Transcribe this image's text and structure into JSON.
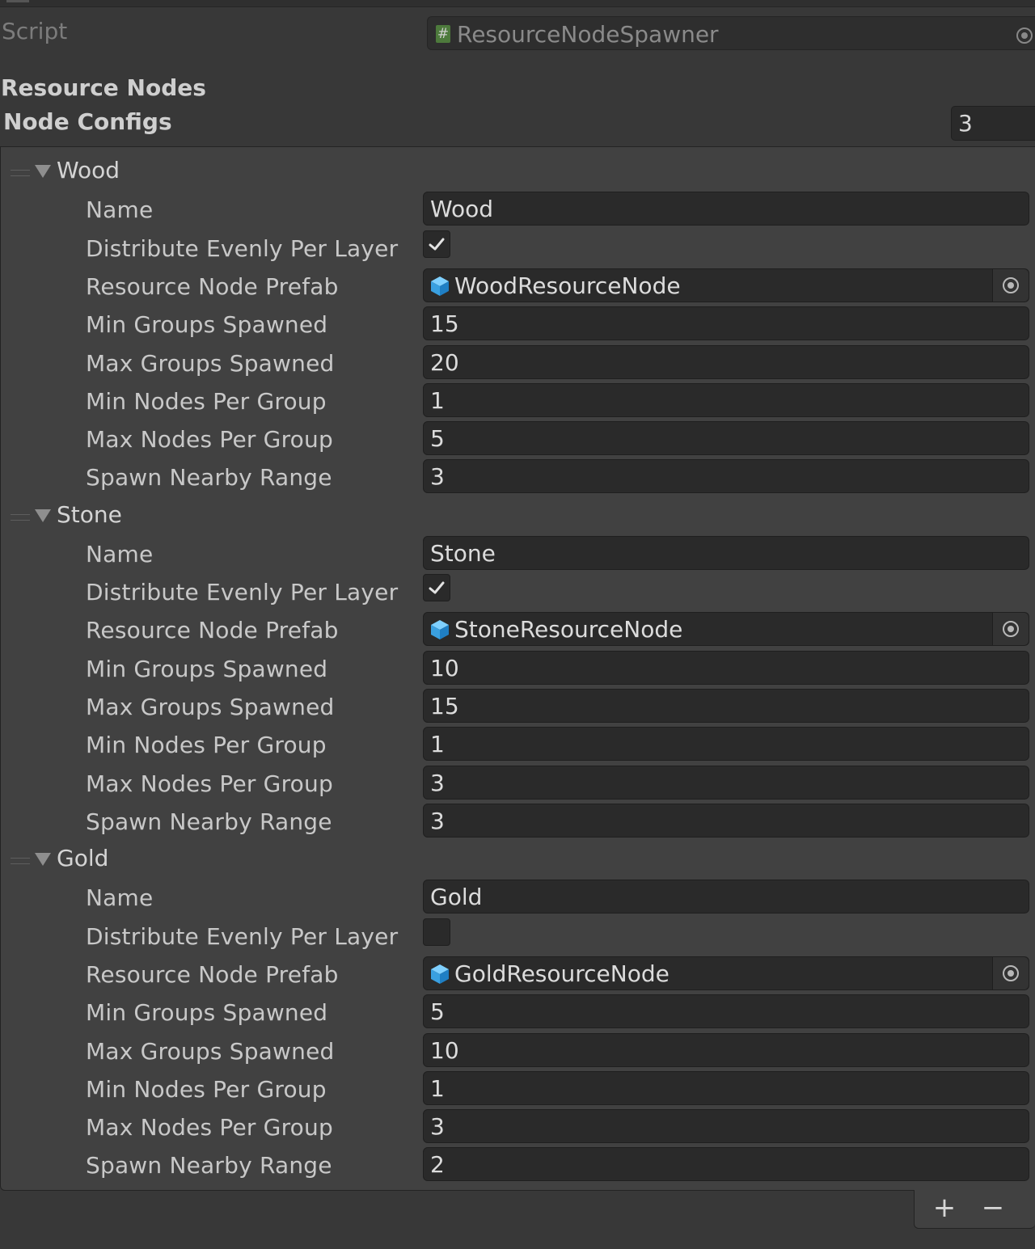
{
  "script": {
    "label": "Script",
    "value": "ResourceNodeSpawner"
  },
  "section_header": "Resource Nodes",
  "list": {
    "label": "Node Configs",
    "size": "3",
    "fields": {
      "name": "Name",
      "distribute": "Distribute Evenly Per Layer",
      "prefab": "Resource Node Prefab",
      "min_groups": "Min Groups Spawned",
      "max_groups": "Max Groups Spawned",
      "min_nodes": "Min Nodes Per Group",
      "max_nodes": "Max Nodes Per Group",
      "range": "Spawn Nearby Range"
    },
    "elements": [
      {
        "title": "Wood",
        "name": "Wood",
        "distribute": true,
        "prefab": "WoodResourceNode",
        "min_groups": "15",
        "max_groups": "20",
        "min_nodes": "1",
        "max_nodes": "5",
        "range": "3"
      },
      {
        "title": "Stone",
        "name": "Stone",
        "distribute": true,
        "prefab": "StoneResourceNode",
        "min_groups": "10",
        "max_groups": "15",
        "min_nodes": "1",
        "max_nodes": "3",
        "range": "3"
      },
      {
        "title": "Gold",
        "name": "Gold",
        "distribute": false,
        "prefab": "GoldResourceNode",
        "min_groups": "5",
        "max_groups": "10",
        "min_nodes": "1",
        "max_nodes": "3",
        "range": "2"
      }
    ],
    "footer": {
      "add": "+",
      "remove": "−"
    }
  },
  "colors": {
    "background": "#383838",
    "list_background": "#414141",
    "field_background": "#2a2a2a",
    "prefab_icon": "#3aa0e0",
    "script_icon": "#4d7a3c"
  },
  "icons": {
    "script": "csharp-script-icon",
    "prefab": "prefab-cube-icon",
    "picker": "object-picker-icon",
    "check": "checkmark-icon"
  }
}
